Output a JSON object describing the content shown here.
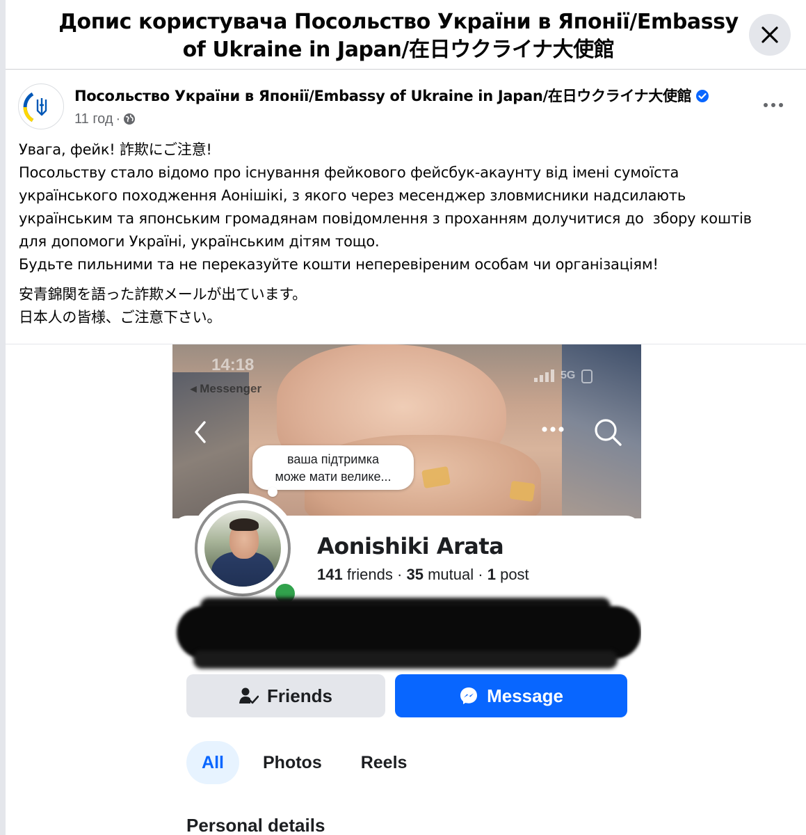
{
  "dialog": {
    "title_line1": "Допис користувача Посольство України в Японії/Embassy",
    "title_line2": "of Ukraine in Japan/在日ウクライナ大使館",
    "close_icon": "close-icon"
  },
  "post": {
    "author": "Посольство України в Японії/Embassy of Ukraine in Japan/在日ウクライナ大使館",
    "time": "11 год",
    "separator": "·",
    "audience_icon": "globe-icon",
    "verified_icon": "verified-badge-icon",
    "more_icon": "more-options-icon",
    "text_ua": "Увага, фейк! 詐欺にご注意!\nПосольству стало відомо про існування фейкового фейсбук-акаунту від імені сумоїста\nукраїнського походження Аонішікі, з якого через месенджер зловмисники надсилають\nукраїнським та японським громадянам повідомлення з проханням долучитися до  збору коштів\nдля допомоги Україні, українським дітям тощо.\nБудьте пильними та не переказуйте кошти неперевіреним особам чи організаціям!",
    "text_jp": "安青錦関を語った詐欺メールが出ています。\n日本人の皆様、ご注意下さい。"
  },
  "screenshot": {
    "status_time": "14:18",
    "status_app": "◂ Messenger",
    "status_network": "5G",
    "bubble_text": "ваша підтримка\nможе мати велике...",
    "profile_name": "Aonishiki Arata",
    "friends_count": "141",
    "friends_label": "friends",
    "mutual_count": "35",
    "mutual_label": "mutual",
    "posts_count": "1",
    "posts_label": "post",
    "dot": "·",
    "friends_button": "Friends",
    "message_button": "Message",
    "tabs": [
      "All",
      "Photos",
      "Reels"
    ],
    "section_title": "Personal details"
  },
  "colors": {
    "accent": "#0866ff",
    "verified": "#0866ff",
    "online": "#31a24c",
    "ukraine_blue": "#0057b7",
    "ukraine_yellow": "#ffd700"
  }
}
